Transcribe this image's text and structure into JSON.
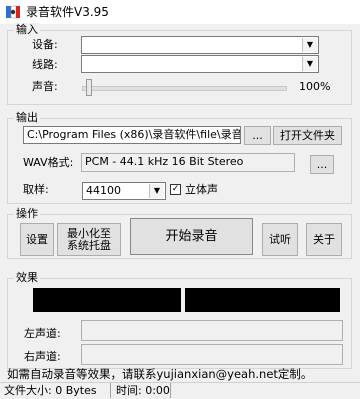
{
  "window": {
    "title": "录音软件V3.95"
  },
  "input_group": {
    "label": "输入",
    "device_label": "设备:",
    "device_value": "",
    "line_label": "线路:",
    "line_value": "",
    "volume_label": "声音:",
    "volume_percent": "100%",
    "volume_level": 0.0
  },
  "output_group": {
    "label": "输出",
    "path_value": "C:\\Program Files (x86)\\录音软件\\file\\录音",
    "browse_button": "...",
    "open_folder_button": "打开文件夹",
    "wav_format_label": "WAV格式:",
    "wav_format_value": "PCM - 44.1 kHz 16 Bit Stereo",
    "format_button": "...",
    "sample_rate_label": "取样:",
    "sample_rate_value": "44100",
    "stereo_label": "立体声",
    "stereo_checked": true
  },
  "operation_group": {
    "label": "操作",
    "settings_button": "设置",
    "minimize_button_line1": "最小化至",
    "minimize_button_line2": "系统托盘",
    "start_record_button": "开始录音",
    "listen_button": "试听",
    "about_button": "关于"
  },
  "effect_group": {
    "label": "效果",
    "left_channel_label": "左声道:",
    "right_channel_label": "右声道:"
  },
  "notice": "如需自动录音等效果，请联系yujianxian@yeah.net定制。",
  "status": {
    "file_size": "文件大小: 0 Bytes",
    "time": "时间: 0:00"
  },
  "colors": {
    "window_bg": "#f0f0f0",
    "meter_bg": "#000000",
    "icon_red": "#d9241c",
    "icon_blue": "#2c6fd6"
  },
  "icons": {
    "app": "microphone-flag-icon",
    "dropdown": "chevron-down-icon",
    "check": "checkmark-icon"
  }
}
